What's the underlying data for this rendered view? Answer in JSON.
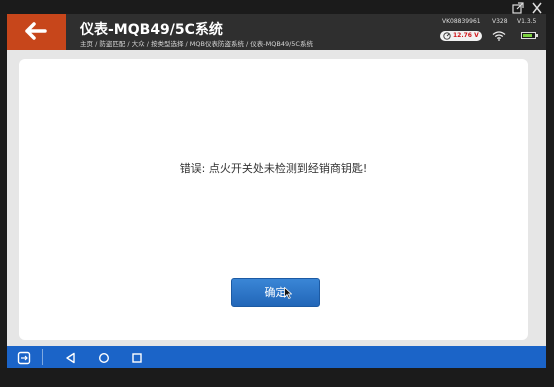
{
  "header": {
    "title": "仪表-MQB49/5C系统",
    "breadcrumb": "主页 / 防盗匹配 / 大众 / 按类型选择 / MQB仪表防盗系统 / 仪表-MQB49/5C系统",
    "vin": "VK08839961",
    "hardware_version": "V328",
    "software_version": "V1.3.5",
    "voltage": "12.76 V"
  },
  "dialog": {
    "message": "错误: 点火开关处未检测到经销商钥匙!",
    "ok_label": "确定"
  },
  "icons": {
    "back": "arrow-left-icon",
    "external": "external-link-icon",
    "close": "close-icon",
    "gauge": "gauge-icon",
    "wifi": "wifi-icon",
    "battery": "battery-icon",
    "remote": "remote-desktop-icon",
    "nav_back": "triangle-back-icon",
    "nav_home": "circle-home-icon",
    "nav_recent": "square-recent-icon"
  },
  "colors": {
    "accent": "#c7461b",
    "header_bg": "#2f2f2f",
    "navbar": "#1b64c8",
    "button": "#2266b8",
    "voltage_text": "#d0161a",
    "battery_fill": "#7bd13f"
  },
  "battery_level": 0.85
}
